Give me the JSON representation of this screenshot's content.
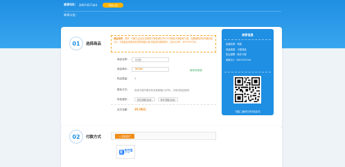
{
  "header": {
    "qq_label": "卖家QQ：",
    "qq_value": "3097457344",
    "notice_button": "商品公告",
    "notice_text": "商家公告："
  },
  "order": {
    "step_number": "01",
    "step_title": "选择商品",
    "description_label": "商品说明：",
    "description_text": "您好！付款之后请点击我的订单查询打开COOK网站卡券密码下载，如果遇到任何问题请加QQ，卡密建议你保存在您的电脑以免卡密遗失造成损失，站长QQ号：3097457344",
    "product_label": "商品名称：",
    "product_value": "5元兑",
    "price_label": "商品单价：",
    "price_value": "35.00",
    "stock_text": "库存非常多",
    "qty_label": "购买数量：",
    "qty_value": "1",
    "pay_label": "联系方式：",
    "pay_value": "查询卡密时需手机号或邮箱(1字符)，可用来找回密码",
    "option_label": "特色服务：",
    "option_tags": [
      "短信提醒(免费)",
      "邮件提醒(免费)"
    ],
    "total_label": "应付总额：",
    "total_value": "35.00元"
  },
  "sidebar": {
    "title": "卖家信息",
    "rows": [
      {
        "label": "店铺名称：",
        "value": "哈哈"
      },
      {
        "label": "商品类型：",
        "value": "卡密商品"
      },
      {
        "label": "售后保障：",
        "value": "新手卡密"
      },
      {
        "label": "卖家QQ：",
        "value": "3097457344"
      }
    ],
    "scan_text": "扫描二维码打开手机支付"
  },
  "payment": {
    "step_number": "02",
    "step_title": "付款方式",
    "tab_label": "在线支付",
    "alipay_cn": "支付宝",
    "alipay_en": "ALIPAY"
  },
  "colors": {
    "primary": "#1f8fe3",
    "accent": "#f08c1a",
    "notice_button": "#ffb400",
    "stock_green": "#2eaa5c",
    "alipay_blue": "#1677ff"
  }
}
